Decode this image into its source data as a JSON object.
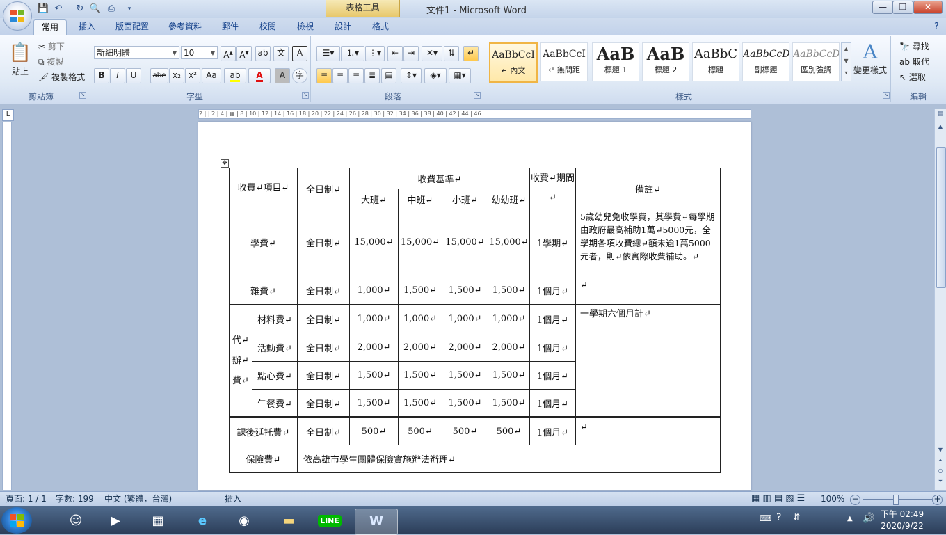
{
  "window": {
    "title": "文件1 - Microsoft Word",
    "context_tab_group": "表格工具",
    "minimize": "—",
    "maximize": "❐",
    "close": "✕"
  },
  "tabs": [
    "常用",
    "插入",
    "版面配置",
    "參考資料",
    "郵件",
    "校閱",
    "檢視",
    "設計",
    "格式"
  ],
  "ribbon": {
    "clipboard": {
      "paste": "貼上",
      "cut": "剪下",
      "copy": "複製",
      "format_painter": "複製格式",
      "label": "剪貼簿"
    },
    "font": {
      "name": "新細明體",
      "size": "10",
      "label": "字型",
      "bold": "B",
      "italic": "I",
      "underline": "U",
      "strike": "abe",
      "sub": "x₂",
      "sup": "x²",
      "case": "Aa"
    },
    "paragraph": {
      "label": "段落"
    },
    "styles": {
      "label": "樣式",
      "items": [
        {
          "sample": "AaBbCcI",
          "name": "↵ 內文"
        },
        {
          "sample": "AaBbCcI",
          "name": "↵ 無間距"
        },
        {
          "sample": "AaB",
          "name": "標題 1"
        },
        {
          "sample": "AaB",
          "name": "標題 2"
        },
        {
          "sample": "AaBbC",
          "name": "標題"
        },
        {
          "sample": "AaBbCcD",
          "name": "副標題"
        },
        {
          "sample": "AaBbCcD",
          "name": "區別強調"
        }
      ],
      "change_styles": "變更樣式"
    },
    "editing": {
      "find": "尋找",
      "replace": "取代",
      "select": "選取",
      "label": "編輯"
    }
  },
  "ruler_marks": "2 | | 2 | 4 | ▦ | 8 | 10 | 12 | 14 | 16 | 18 | 20 | 22 | 24 | 26 | 28 | 30 | 32 | 34 | 36 | 38 | 40 | 42 | 44 | 46",
  "table": {
    "header": {
      "item": "收費↵項目↵",
      "system": "全日制↵",
      "standard": "收費基準↵",
      "period": "收費↵期間↵",
      "note": "備註↵",
      "classes": [
        "大班↵",
        "中班↵",
        "小班↵",
        "幼幼班↵"
      ]
    },
    "tuition": {
      "item": "學費↵",
      "system": "全日制↵",
      "values": [
        "15,000↵",
        "15,000↵",
        "15,000↵",
        "15,000↵"
      ],
      "period": "1學期↵",
      "note": "5歲幼兒免收學費，其學費↵每學期由政府最高補助1萬↵5000元，全學期各項收費總↵額未逾1萬5000元者，則↵依實際收費補助。↵"
    },
    "misc": {
      "item": "雜費↵",
      "system": "全日制↵",
      "values": [
        "1,000↵",
        "1,500↵",
        "1,500↵",
        "1,500↵"
      ],
      "period": "1個月↵",
      "note": "↵"
    },
    "agency_label": "代↵辦↵費↵",
    "agency_note": "一學期六個月計↵",
    "agency": [
      {
        "item": "材料費↵",
        "system": "全日制↵",
        "values": [
          "1,000↵",
          "1,000↵",
          "1,000↵",
          "1,000↵"
        ],
        "period": "1個月↵"
      },
      {
        "item": "活動費↵",
        "system": "全日制↵",
        "values": [
          "2,000↵",
          "2,000↵",
          "2,000↵",
          "2,000↵"
        ],
        "period": "1個月↵"
      },
      {
        "item": "點心費↵",
        "system": "全日制↵",
        "values": [
          "1,500↵",
          "1,500↵",
          "1,500↵",
          "1,500↵"
        ],
        "period": "1個月↵"
      },
      {
        "item": "午餐費↵",
        "system": "全日制↵",
        "values": [
          "1,500↵",
          "1,500↵",
          "1,500↵",
          "1,500↵"
        ],
        "period": "1個月↵"
      }
    ],
    "aftercare": {
      "item": "課後延托費↵",
      "system": "全日制↵",
      "values": [
        "500↵",
        "500↵",
        "500↵",
        "500↵"
      ],
      "period": "1個月↵",
      "note": "↵"
    },
    "insurance": {
      "item": "保險費↵",
      "text": "依高雄市學生團體保險實施辦法辦理↵"
    }
  },
  "status": {
    "page": "頁面: 1 / 1",
    "words": "字數: 199",
    "language": "中文 (繁體，台灣)",
    "mode": "插入",
    "zoom": "100%"
  },
  "taskbar": {
    "time": "下午 02:49",
    "date": "2020/9/22"
  },
  "colors": {
    "ribbon_text": "#15428b",
    "selected_style": "#ffe8a8",
    "taskbar": "#2b3d58"
  }
}
